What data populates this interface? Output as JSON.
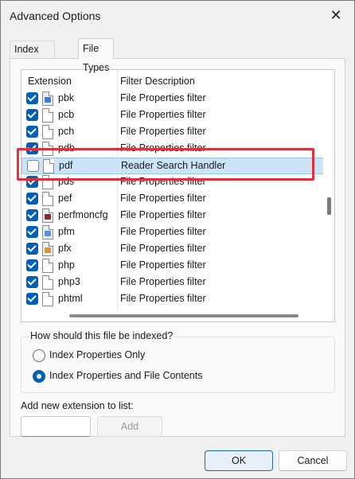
{
  "window": {
    "title": "Advanced Options",
    "close_glyph": "✕"
  },
  "tabs": [
    {
      "label": "Index Settings",
      "active": false
    },
    {
      "label": "File Types",
      "active": true
    }
  ],
  "list": {
    "headers": {
      "extension": "Extension",
      "description": "Filter Description"
    },
    "rows": [
      {
        "ext": "pbk",
        "desc": "File Properties filter",
        "checked": true,
        "icon": "phonebook-icon"
      },
      {
        "ext": "pcb",
        "desc": "File Properties filter",
        "checked": true,
        "icon": "file-icon"
      },
      {
        "ext": "pch",
        "desc": "File Properties filter",
        "checked": true,
        "icon": "file-icon"
      },
      {
        "ext": "pdb",
        "desc": "File Properties filter",
        "checked": true,
        "icon": "file-icon"
      },
      {
        "ext": "pdf",
        "desc": "Reader Search Handler",
        "checked": false,
        "icon": "file-icon",
        "selected": true
      },
      {
        "ext": "pds",
        "desc": "File Properties filter",
        "checked": true,
        "icon": "file-icon"
      },
      {
        "ext": "pef",
        "desc": "File Properties filter",
        "checked": true,
        "icon": "file-icon"
      },
      {
        "ext": "perfmoncfg",
        "desc": "File Properties filter",
        "checked": true,
        "icon": "perfmon-icon"
      },
      {
        "ext": "pfm",
        "desc": "File Properties filter",
        "checked": true,
        "icon": "font-file-icon"
      },
      {
        "ext": "pfx",
        "desc": "File Properties filter",
        "checked": true,
        "icon": "certificate-icon"
      },
      {
        "ext": "php",
        "desc": "File Properties filter",
        "checked": true,
        "icon": "file-icon"
      },
      {
        "ext": "php3",
        "desc": "File Properties filter",
        "checked": true,
        "icon": "file-icon"
      },
      {
        "ext": "phtml",
        "desc": "File Properties filter",
        "checked": true,
        "icon": "file-icon"
      }
    ]
  },
  "index_group": {
    "title": "How should this file be indexed?",
    "options": [
      {
        "label": "Index Properties Only",
        "selected": false
      },
      {
        "label": "Index Properties and File Contents",
        "selected": true
      }
    ]
  },
  "add_extension": {
    "label": "Add new extension to list:",
    "value": "",
    "button": "Add"
  },
  "buttons": {
    "ok": "OK",
    "cancel": "Cancel"
  },
  "colors": {
    "accent": "#005fb8",
    "highlight": "#e0303c",
    "selected_row": "#cce4f7"
  }
}
